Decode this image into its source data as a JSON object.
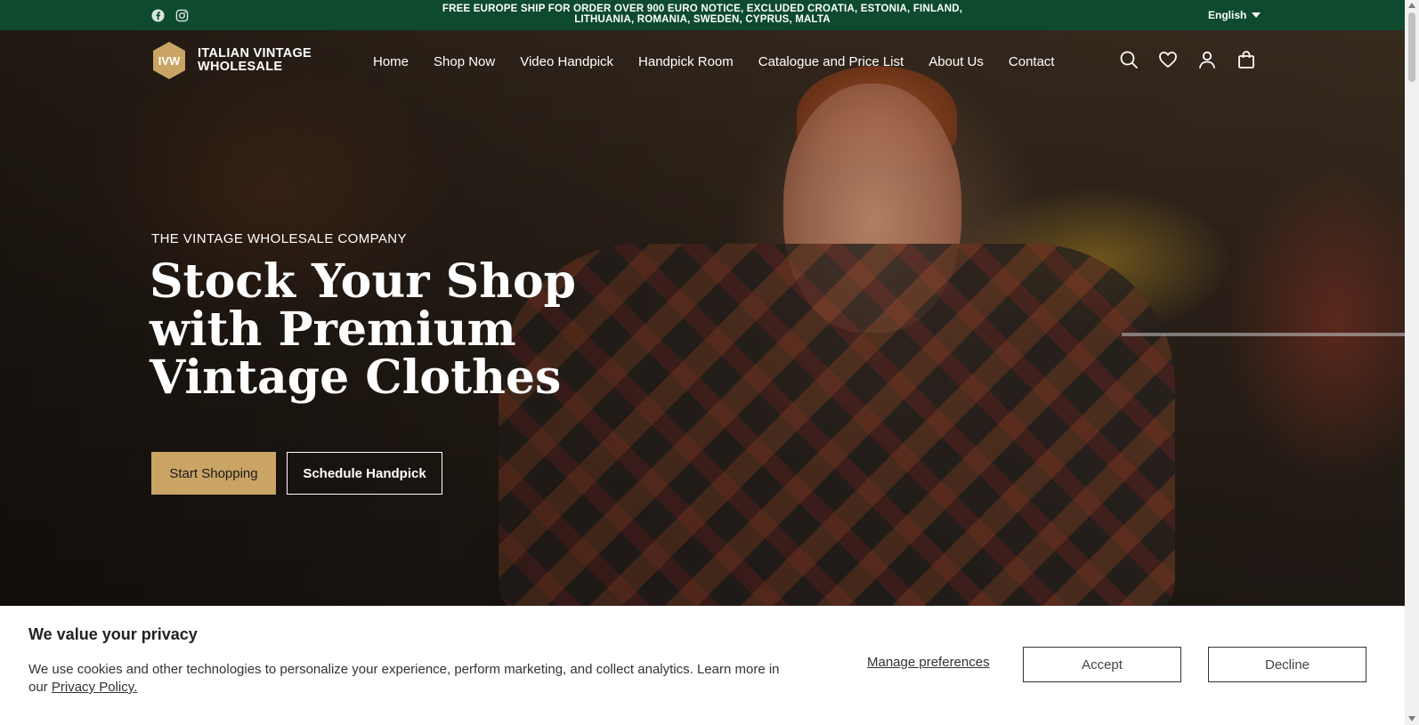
{
  "topbar": {
    "announcement": "FREE EUROPE SHIP FOR ORDER OVER 900 EURO NOTICE, EXCLUDED CROATIA, ESTONIA, FINLAND, LITHUANIA, ROMANIA, SWEDEN, CYPRUS, MALTA",
    "language": "English",
    "social_icons": [
      "facebook-icon",
      "instagram-icon"
    ]
  },
  "header": {
    "logo_mark": "IVW",
    "logo_name": "ITALIAN VINTAGE WHOLESALE",
    "nav": [
      {
        "label": "Home"
      },
      {
        "label": "Shop Now"
      },
      {
        "label": "Video Handpick"
      },
      {
        "label": "Handpick Room"
      },
      {
        "label": "Catalogue and Price List"
      },
      {
        "label": "About Us"
      },
      {
        "label": "Contact"
      }
    ],
    "icons": [
      "search-icon",
      "wishlist-icon",
      "account-icon",
      "cart-icon"
    ]
  },
  "hero": {
    "eyebrow": "THE VINTAGE WHOLESALE COMPANY",
    "headline": "Stock Your Shop with Premium Vintage Clothes",
    "primary_cta": "Start Shopping",
    "secondary_cta": "Schedule Handpick"
  },
  "cookie": {
    "title": "We value your privacy",
    "text": "We use cookies and other technologies to personalize your experience, perform marketing, and collect analytics. Learn more in our",
    "link": "Privacy Policy.",
    "manage": "Manage preferences",
    "accept": "Accept",
    "decline": "Decline"
  },
  "colors": {
    "topbar_bg": "#0d4a2e",
    "primary_button": "#c9a464",
    "logo_hex": "#c9a464"
  }
}
